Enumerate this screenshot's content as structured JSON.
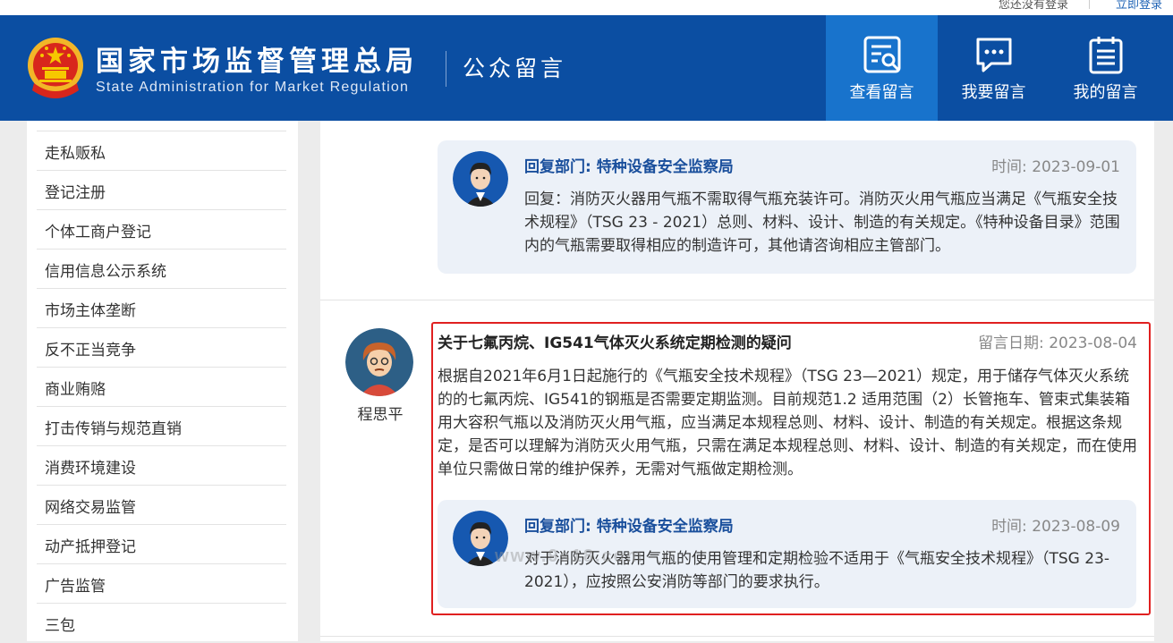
{
  "top": {
    "login_status": "您还没有登录",
    "login_link": "立即登录"
  },
  "header": {
    "org_name_cn": "国家市场监督管理总局",
    "org_name_en": "State Administration for Market Regulation",
    "section_title": "公众留言",
    "nav": [
      {
        "label": "查看留言",
        "icon": "view-messages-icon",
        "active": true
      },
      {
        "label": "我要留言",
        "icon": "write-message-icon",
        "active": false
      },
      {
        "label": "我的留言",
        "icon": "my-messages-icon",
        "active": false
      }
    ]
  },
  "sidebar": {
    "items": [
      {
        "label": "走私贩私"
      },
      {
        "label": "登记注册"
      },
      {
        "label": "个体工商户登记"
      },
      {
        "label": "信用信息公示系统"
      },
      {
        "label": "市场主体垄断"
      },
      {
        "label": "反不正当竞争"
      },
      {
        "label": "商业贿赂"
      },
      {
        "label": "打击传销与规范直销"
      },
      {
        "label": "消费环境建设"
      },
      {
        "label": "网络交易监管"
      },
      {
        "label": "动产抵押登记"
      },
      {
        "label": "广告监管"
      },
      {
        "label": "三包"
      }
    ]
  },
  "messages": {
    "previous_reply": {
      "dept": "回复部门: 特种设备安全监察局",
      "time": "时间:  2023-09-01",
      "body": "回复：消防灭火器用气瓶不需取得气瓶充装许可。消防灭火用气瓶应当满足《气瓶安全技术规程》（TSG 23 - 2021）总则、材料、设计、制造的有关规定。《特种设备目录》范围内的气瓶需要取得相应的制造许可，其他请咨询相应主管部门。"
    },
    "question": {
      "asker": "程思平",
      "title": "关于七氟丙烷、IG541气体灭火系统定期检测的疑问",
      "date": "留言日期:  2023-08-04",
      "body": "根据自2021年6月1日起施行的《气瓶安全技术规程》（TSG 23—2021）规定，用于储存气体灭火系统的的七氟丙烷、IG541的钢瓶是否需要定期监测。目前规范1.2 适用范围（2）长管拖车、管束式集装箱用大容积气瓶以及消防灭火用气瓶，应当满足本规程总则、材料、设计、制造的有关规定。根据这条规定，是否可以理解为消防灭火用气瓶，只需在满足本规程总则、材料、设计、制造的有关规定，而在使用单位只需做日常的维护保养，无需对气瓶做定期检测。"
    },
    "question_reply": {
      "dept": "回复部门: 特种设备安全监察局",
      "time": "时间:  2023-08-09",
      "body": "对于消防灭火器用气瓶的使用管理和定期检验不适用于《气瓶安全技术规程》（TSG 23-2021），应按照公安消防等部门的要求执行。"
    }
  },
  "watermark": "www.9s18.com",
  "colors": {
    "header_bg": "#0b4ea2",
    "active_nav_bg": "#1873cc",
    "reply_bg": "#ecf1f8",
    "dept_text": "#1a4f9c",
    "highlight_border": "#e02020"
  }
}
